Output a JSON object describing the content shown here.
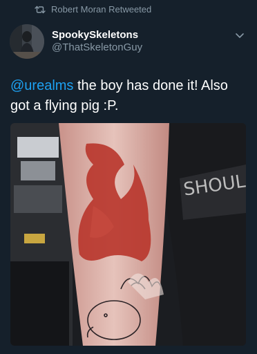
{
  "retweet": {
    "text": "Robert Moran Retweeted",
    "icon": "retweet-icon"
  },
  "author": {
    "display_name": "SpookySkeletons",
    "handle": "@ThatSkeletonGuy"
  },
  "tweet": {
    "mention": "@urealms",
    "text": " the boy has done it! Also got a flying pig :P."
  },
  "media": {
    "shirt_text": "SHOULAT"
  },
  "colors": {
    "background": "#15202b",
    "secondary_text": "#8899a6",
    "link": "#1da1f2"
  }
}
